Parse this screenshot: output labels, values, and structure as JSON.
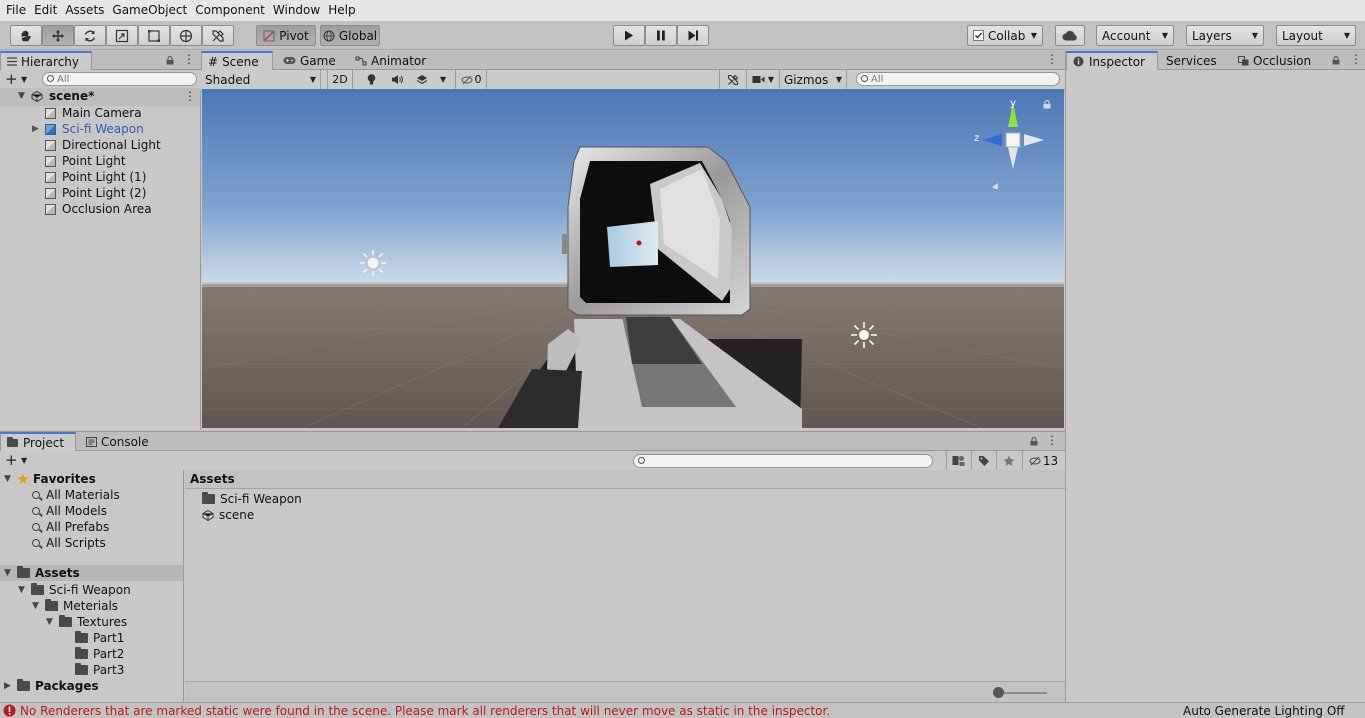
{
  "menu": [
    "File",
    "Edit",
    "Assets",
    "GameObject",
    "Component",
    "Window",
    "Help"
  ],
  "toolbar": {
    "pivot": "Pivot",
    "global": "Global",
    "collab": "Collab",
    "account": "Account",
    "layers": "Layers",
    "layout": "Layout"
  },
  "hierarchy": {
    "tab": "Hierarchy",
    "search_placeholder": "All",
    "scene": "scene*",
    "items": [
      "Main Camera",
      "Sci-fi Weapon",
      "Directional Light",
      "Point Light",
      "Point Light (1)",
      "Point Light (2)",
      "Occlusion Area"
    ],
    "selected_color": "#2b5fa8"
  },
  "scene_tabs": [
    "Scene",
    "Game",
    "Animator"
  ],
  "scene_toolbar": {
    "shading": "Shaded",
    "mode2d": "2D",
    "hidden_count": "0",
    "gizmos": "Gizmos",
    "search_placeholder": "All"
  },
  "gizmo": {
    "y": "y",
    "z": "z"
  },
  "inspector_tabs": [
    "Inspector",
    "Services",
    "Occlusion"
  ],
  "project": {
    "tabs": [
      "Project",
      "Console"
    ],
    "hidden_count": "13",
    "favorites_label": "Favorites",
    "favorites": [
      "All Materials",
      "All Models",
      "All Prefabs",
      "All Scripts"
    ],
    "assets_label": "Assets",
    "tree": [
      {
        "label": "Sci-fi Weapon",
        "depth": 1
      },
      {
        "label": "Meterials",
        "depth": 2
      },
      {
        "label": "Textures",
        "depth": 3
      },
      {
        "label": "Part1",
        "depth": 4
      },
      {
        "label": "Part2",
        "depth": 4
      },
      {
        "label": "Part3",
        "depth": 4
      }
    ],
    "packages_label": "Packages",
    "breadcrumb": "Assets",
    "files": [
      {
        "label": "Sci-fi Weapon",
        "icon": "folder-icon"
      },
      {
        "label": "scene",
        "icon": "unity-scene-icon"
      }
    ]
  },
  "status": {
    "message": "No Renderers that are marked static were found in the scene. Please mark all renderers that will never move as static in the inspector.",
    "lighting": "Auto Generate Lighting Off",
    "error_color": "#c01818"
  }
}
